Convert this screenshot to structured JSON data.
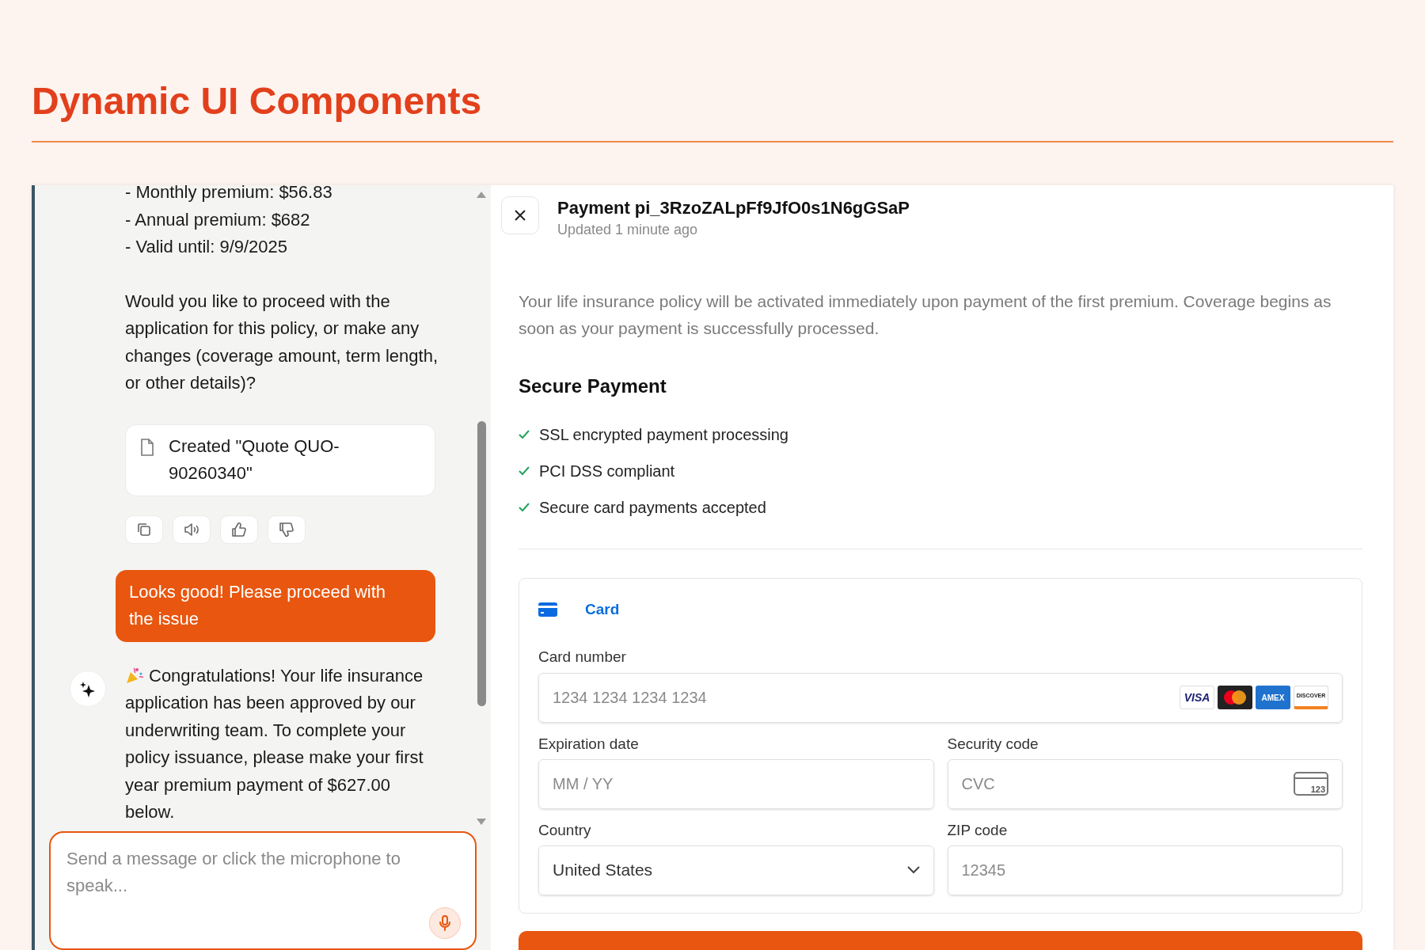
{
  "page_title": "Dynamic UI Components",
  "chat": {
    "messages": [
      {
        "kind": "lines",
        "lines": [
          "- Monthly premium: $56.83",
          "- Annual premium: $682",
          "- Valid until: 9/9/2025"
        ]
      },
      {
        "kind": "paragraph",
        "text": "Would you like to proceed with the application for this policy, or make any changes (coverage amount, term length, or other details)?"
      },
      {
        "kind": "artifact",
        "text": "Created \"Quote QUO-90260340\""
      },
      {
        "kind": "actions"
      },
      {
        "kind": "user",
        "text": "Looks good! Please proceed with the issue"
      },
      {
        "kind": "assistant",
        "text": "Congratulations! Your life insurance application has been approved by our underwriting team. To complete your policy issuance, please make your first year premium payment of $627.00 below."
      }
    ],
    "input": {
      "placeholder": "Send a message or click the microphone to speak..."
    }
  },
  "payment": {
    "title": "Payment pi_3RzoZALpFf9JfO0s1N6gGSaP",
    "subtitle": "Updated 1 minute ago",
    "intro": "Your life insurance policy will be activated immediately upon payment of the first premium. Coverage begins as soon as your payment is successfully processed.",
    "secure_heading": "Secure Payment",
    "features": [
      "SSL encrypted payment processing",
      "PCI DSS compliant",
      "Secure card payments accepted"
    ],
    "tabs": [
      {
        "label": "Card",
        "selected": true
      }
    ],
    "card_number": {
      "label": "Card number",
      "placeholder": "1234 1234 1234 1234"
    },
    "brands": [
      {
        "kind": "visa",
        "label": "VISA"
      },
      {
        "kind": "mastercard"
      },
      {
        "kind": "amex",
        "label": "AMEX"
      },
      {
        "kind": "discover",
        "label": "DISCOVER"
      }
    ],
    "expiration": {
      "label": "Expiration date",
      "placeholder": "MM / YY"
    },
    "security": {
      "label": "Security code",
      "placeholder": "CVC",
      "icon_text": "123"
    },
    "country": {
      "label": "Country",
      "value": "United States"
    },
    "zip": {
      "label": "ZIP code",
      "placeholder": "12345"
    }
  }
}
